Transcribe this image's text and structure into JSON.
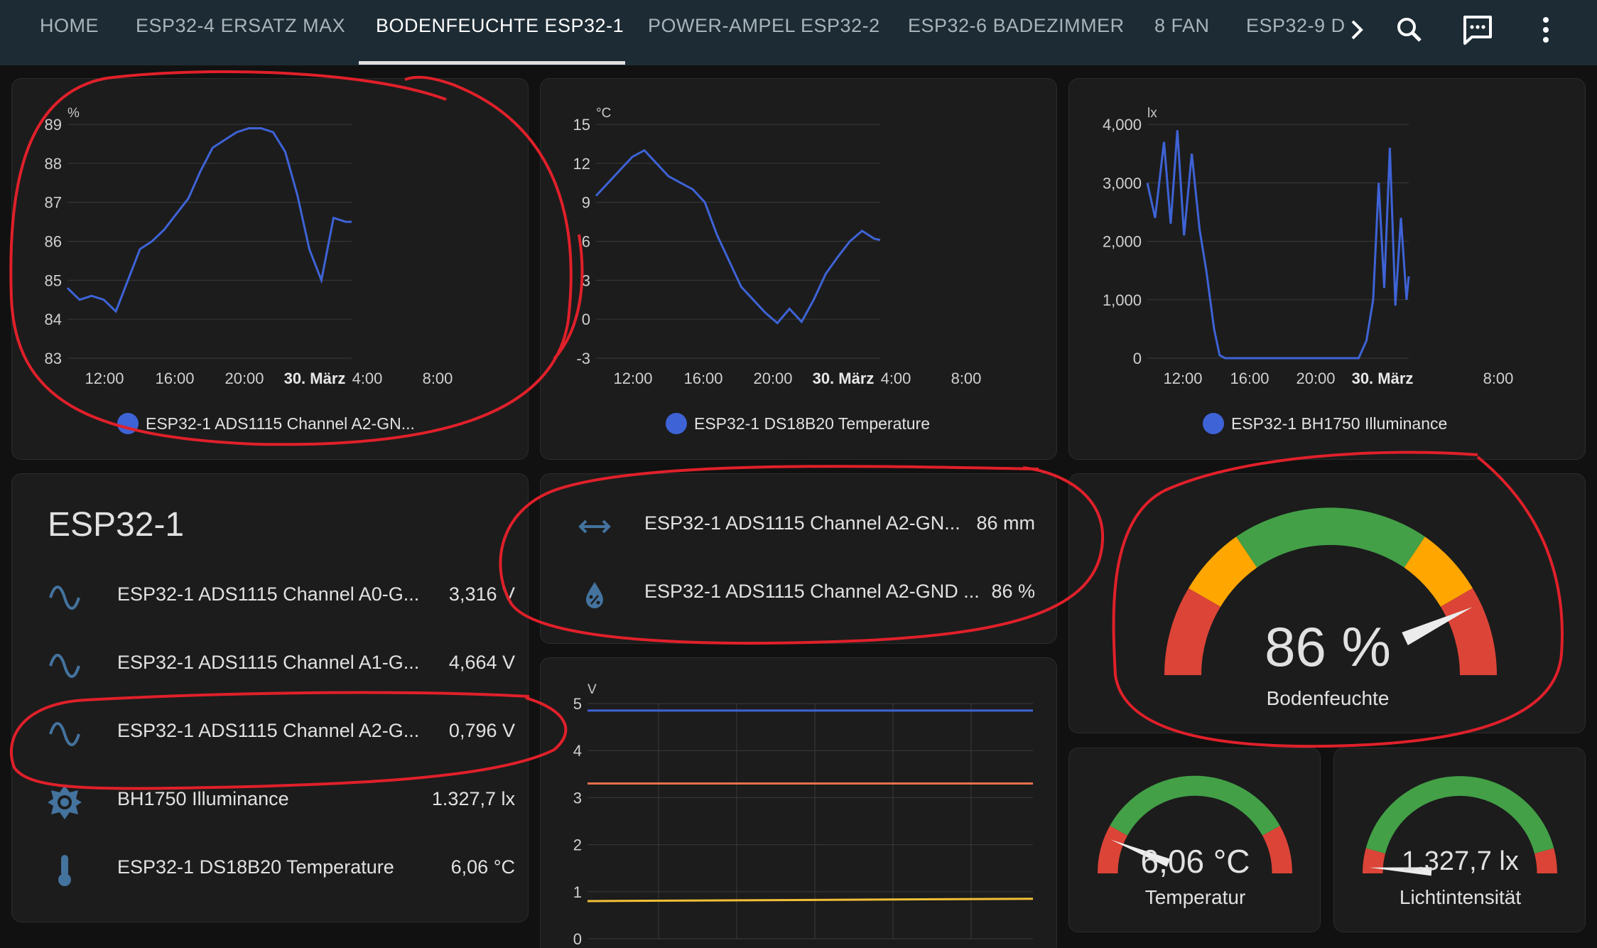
{
  "tabs": [
    {
      "label": "HOME",
      "active": false
    },
    {
      "label": "ESP32-4 ERSATZ MAX",
      "active": false
    },
    {
      "label": "BODENFEUCHTE ESP32-1",
      "active": true
    },
    {
      "label": "POWER-AMPEL ESP32-2",
      "active": false
    },
    {
      "label": "ESP32-6 BADEZIMMER",
      "active": false
    },
    {
      "label": "8 FAN",
      "active": false
    },
    {
      "label": "ESP32-9 D",
      "active": false
    }
  ],
  "toolbar_icons": [
    "chevron-right-icon",
    "search-icon",
    "assist-chat-icon",
    "more-vertical-icon"
  ],
  "colors": {
    "series_blue": "#3e63d6",
    "series_orange": "#e8714a",
    "series_yellow": "#f2c037",
    "gauge_red": "#db4437",
    "gauge_orange": "#ffa600",
    "gauge_green": "#43a047",
    "annotation_red": "#e0202a"
  },
  "history_cards": [
    {
      "unit": "%",
      "legend": "ESP32-1 ADS1115 Channel A2-GN...",
      "y_ticks": [
        "89",
        "88",
        "87",
        "86",
        "85",
        "84",
        "83"
      ],
      "x_ticks": [
        "12:00",
        "16:00",
        "20:00",
        "30. März",
        "4:00",
        "8:00"
      ]
    },
    {
      "unit": "°C",
      "legend": "ESP32-1 DS18B20 Temperature",
      "y_ticks": [
        "15",
        "12",
        "9",
        "6",
        "3",
        "0",
        "-3"
      ],
      "x_ticks": [
        "12:00",
        "16:00",
        "20:00",
        "30. März",
        "4:00",
        "8:00"
      ]
    },
    {
      "unit": "lx",
      "legend": "ESP32-1 BH1750 Illuminance",
      "y_ticks": [
        "4,000",
        "3,000",
        "2,000",
        "1,000",
        "0"
      ],
      "x_ticks": [
        "12:00",
        "16:00",
        "20:00",
        "30. März",
        "8:00"
      ]
    }
  ],
  "chart_data": [
    {
      "type": "line",
      "unit": "%",
      "ylim": [
        83,
        89
      ],
      "x_ticks": [
        "12:00",
        "16:00",
        "20:00",
        "30. März",
        "4:00",
        "8:00"
      ],
      "series": [
        {
          "name": "ESP32-1 ADS1115 Channel A2-GN...",
          "x": [
            10.5,
            11.5,
            12.5,
            13.5,
            14.5,
            15.5,
            16.5,
            17.5,
            18.5,
            19.5,
            20.5,
            21.5,
            22.5,
            23.5,
            24.5,
            25.5,
            26.5,
            27.5,
            28.5,
            29.5,
            30.5,
            31.5,
            32.5,
            33.5,
            34.0
          ],
          "y": [
            84.8,
            84.5,
            84.6,
            84.5,
            84.2,
            85.0,
            85.8,
            86.0,
            86.3,
            86.7,
            87.1,
            87.8,
            88.4,
            88.6,
            88.8,
            88.9,
            88.9,
            88.8,
            88.3,
            87.2,
            85.8,
            85.0,
            86.6,
            86.5,
            86.5
          ]
        }
      ]
    },
    {
      "type": "line",
      "unit": "°C",
      "ylim": [
        -3,
        15
      ],
      "x_ticks": [
        "12:00",
        "16:00",
        "20:00",
        "30. März",
        "4:00",
        "8:00"
      ],
      "series": [
        {
          "name": "ESP32-1 DS18B20 Temperature",
          "x": [
            10.5,
            11.5,
            12.5,
            13.5,
            14.5,
            15.5,
            16.5,
            17.5,
            18.5,
            19.5,
            20.5,
            21.5,
            22.5,
            23.5,
            24.5,
            25.5,
            26.5,
            27.5,
            28.5,
            29.5,
            30.5,
            31.5,
            32.5,
            33.5,
            34.0
          ],
          "y": [
            9.5,
            10.5,
            11.5,
            12.5,
            13.0,
            12.0,
            11.0,
            10.5,
            10.0,
            9.0,
            6.5,
            4.5,
            2.5,
            1.5,
            0.5,
            -0.3,
            0.8,
            -0.2,
            1.5,
            3.5,
            4.8,
            6.0,
            6.8,
            6.2,
            6.1
          ]
        }
      ]
    },
    {
      "type": "line",
      "unit": "lx",
      "ylim": [
        0,
        4000
      ],
      "x_ticks": [
        "12:00",
        "16:00",
        "20:00",
        "30. März",
        "8:00"
      ],
      "series": [
        {
          "name": "ESP32-1 BH1750 Illuminance",
          "x": [
            10.5,
            11.2,
            12.0,
            12.6,
            13.2,
            13.8,
            14.5,
            15.2,
            15.8,
            16.5,
            17.0,
            17.5,
            18.5,
            20.0,
            22.0,
            24.0,
            26.0,
            28.0,
            29.5,
            30.2,
            30.8,
            31.3,
            31.8,
            32.3,
            32.8,
            33.3,
            33.8,
            34.0
          ],
          "y": [
            3000,
            2400,
            3700,
            2300,
            3900,
            2100,
            3500,
            2200,
            1500,
            500,
            50,
            0,
            0,
            0,
            0,
            0,
            0,
            0,
            0,
            300,
            1000,
            3000,
            1200,
            3600,
            900,
            2400,
            1000,
            1400
          ]
        }
      ]
    },
    {
      "type": "line",
      "unit": "V",
      "ylim": [
        0,
        5
      ],
      "y_ticks": [
        "5",
        "4",
        "3",
        "2",
        "1",
        "0"
      ],
      "series": [
        {
          "x": [
            0,
            1
          ],
          "y": [
            4.85,
            4.85
          ],
          "color": "#3e63d6"
        },
        {
          "x": [
            0,
            1
          ],
          "y": [
            3.3,
            3.3
          ],
          "color": "#e8714a"
        },
        {
          "x": [
            0,
            1
          ],
          "y": [
            0.8,
            0.85
          ],
          "color": "#f2c037"
        }
      ]
    }
  ],
  "entities_card": {
    "title": "ESP32-1",
    "rows": [
      {
        "icon": "sine-wave-icon",
        "name": "ESP32-1 ADS1115 Channel A0-G...",
        "value": "3,316 V"
      },
      {
        "icon": "sine-wave-icon",
        "name": "ESP32-1 ADS1115 Channel A1-G...",
        "value": "4,664 V"
      },
      {
        "icon": "sine-wave-icon",
        "name": "ESP32-1 ADS1115 Channel A2-G...",
        "value": "0,796 V"
      },
      {
        "icon": "brightness-icon",
        "name": "BH1750 Illuminance",
        "value": "1.327,7 lx"
      },
      {
        "icon": "thermometer-icon",
        "name": "ESP32-1 DS18B20 Temperature",
        "value": "6,06 °C"
      }
    ]
  },
  "small_entities": [
    {
      "icon": "distance-arrows-icon",
      "name": "ESP32-1 ADS1115 Channel A2-GN...",
      "value": "86 mm"
    },
    {
      "icon": "water-percent-icon",
      "name": "ESP32-1 ADS1115 Channel A2-GND ...",
      "value": "86 %"
    }
  ],
  "voltage_chart": {
    "unit": "V",
    "y_ticks": [
      "5",
      "4",
      "3",
      "2",
      "1",
      "0"
    ]
  },
  "gauges": {
    "main": {
      "value_text": "86 %",
      "name": "Bodenfeuchte",
      "value": 86
    },
    "temperature": {
      "value_text": "6,06 °C",
      "name": "Temperatur",
      "value": 6.06
    },
    "light": {
      "value_text": "1.327,7 lx",
      "name": "Lichtintensität",
      "value": 1327.7
    }
  }
}
